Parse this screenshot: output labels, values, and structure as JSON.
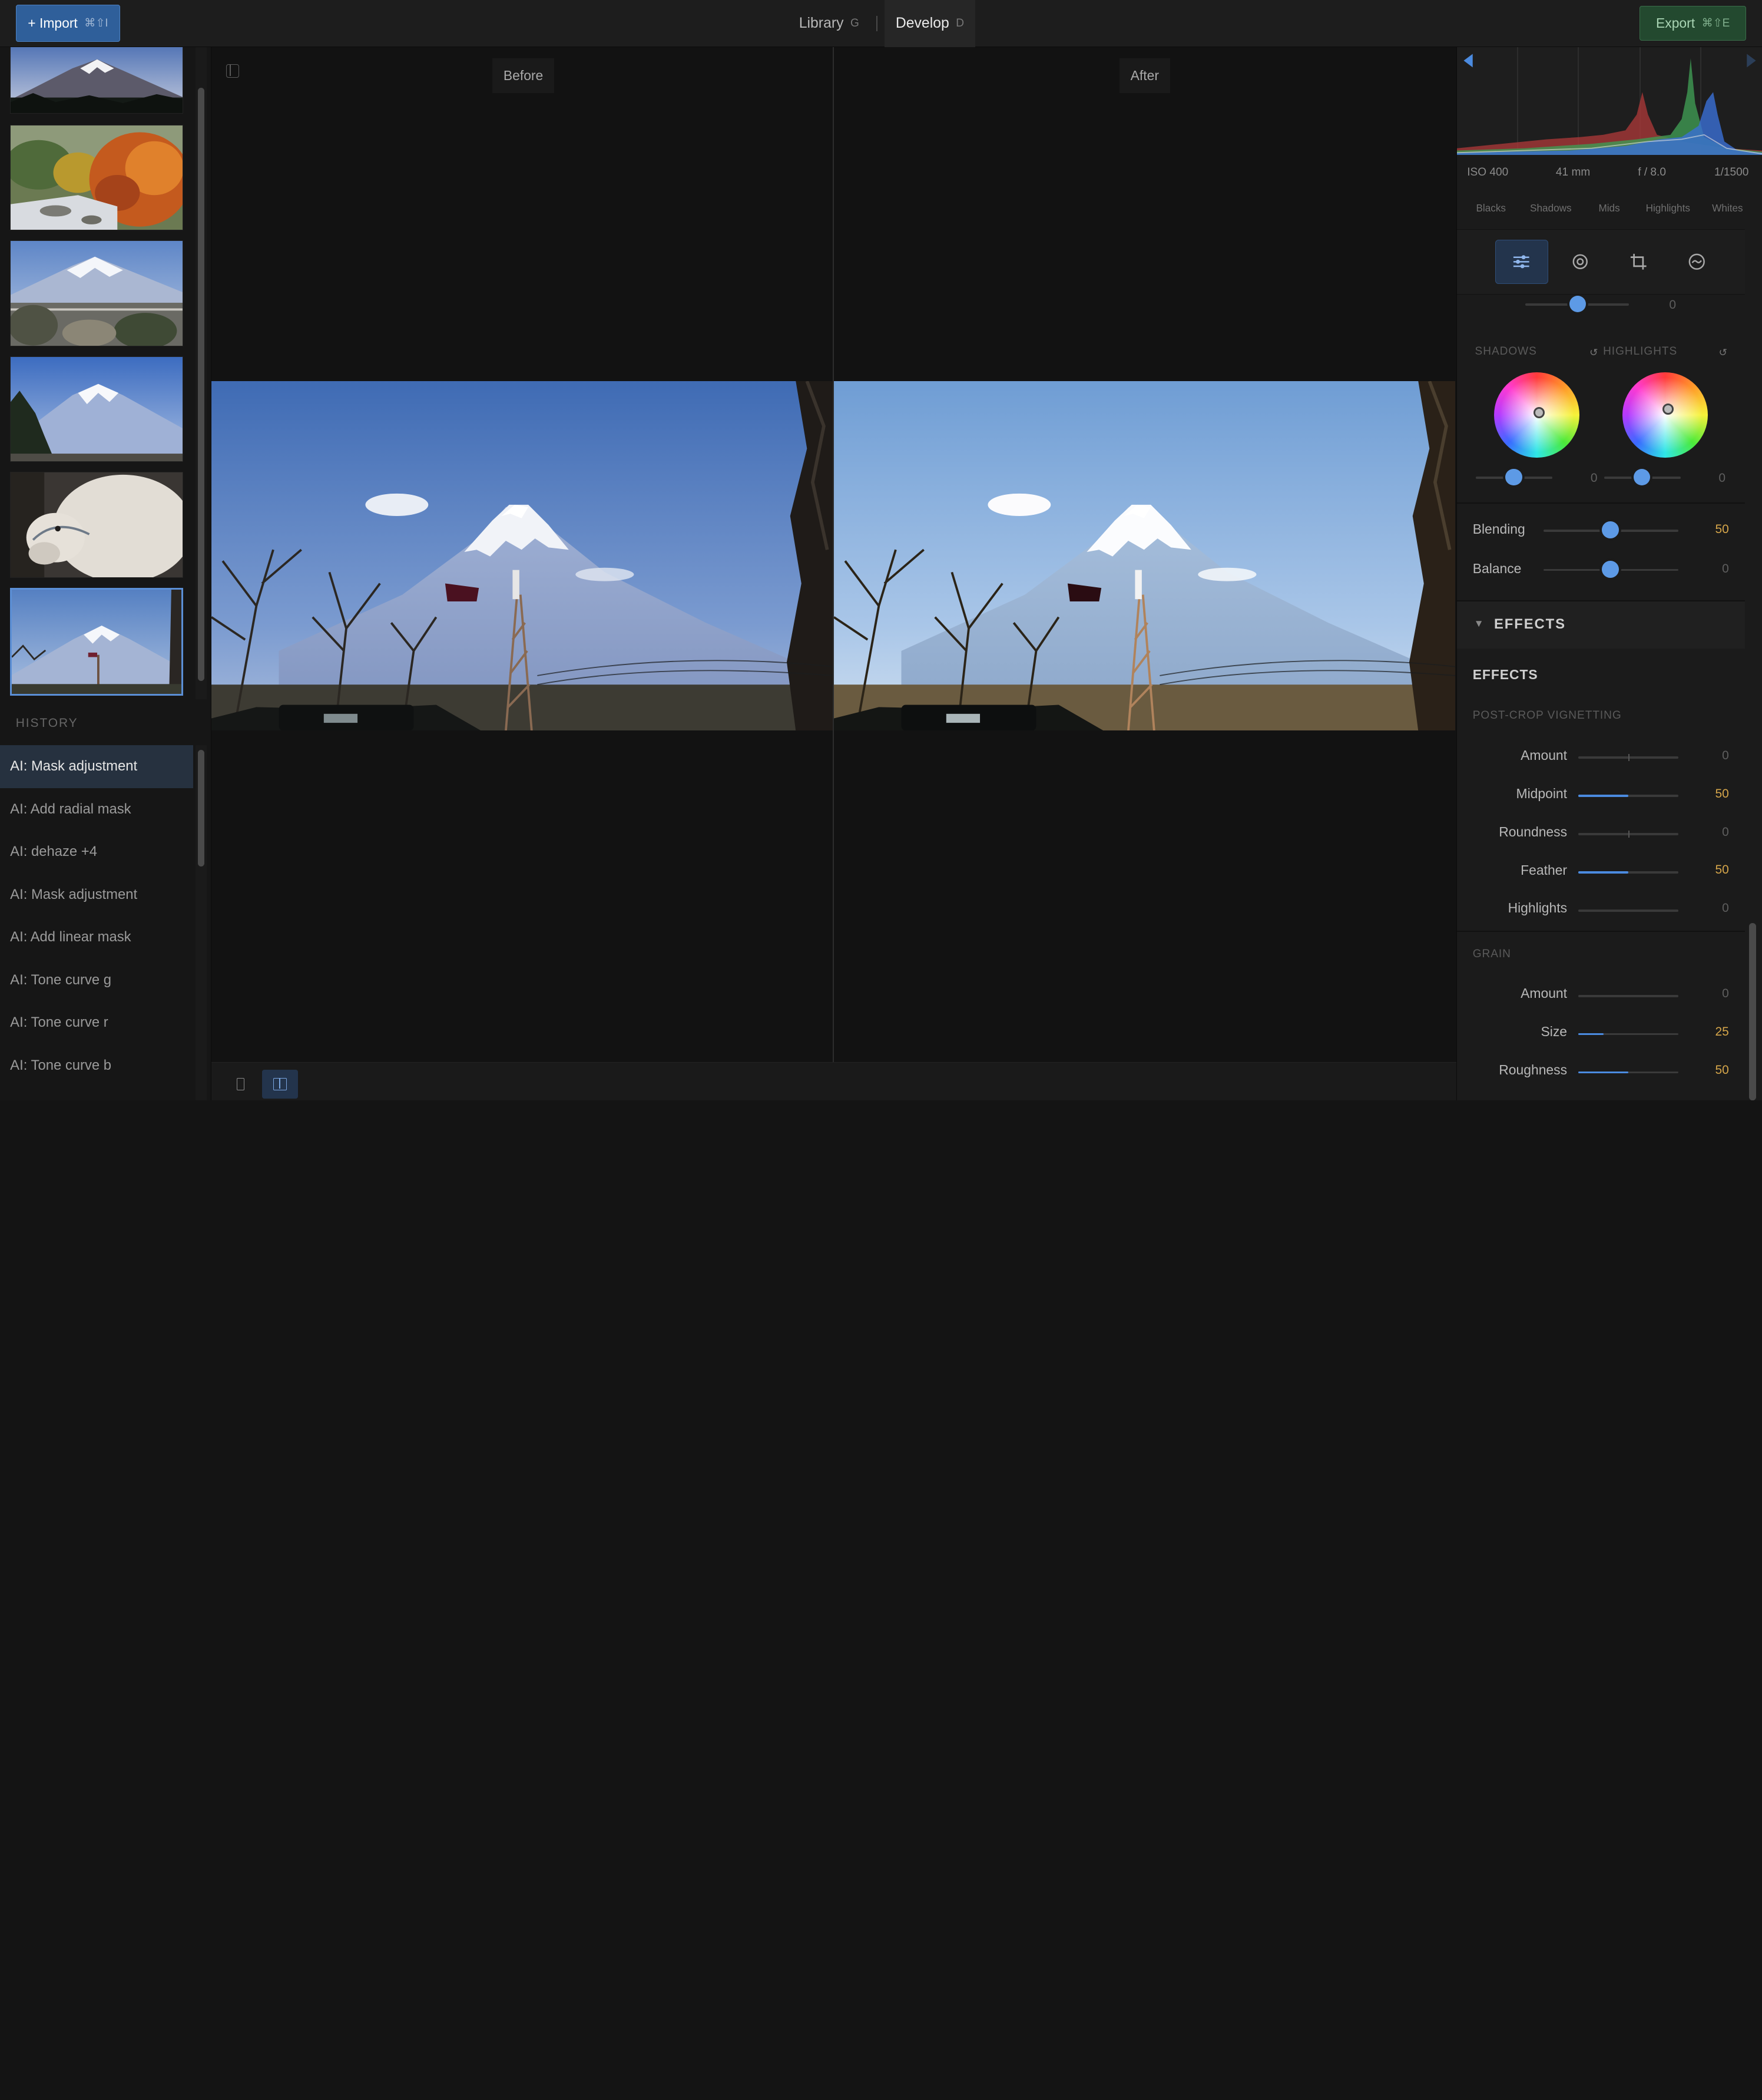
{
  "topbar": {
    "import_label": "+ Import",
    "import_shortcut": "⌘⇧I",
    "tabs": [
      {
        "label": "Library",
        "key": "G"
      },
      {
        "label": "Develop",
        "key": "D"
      }
    ],
    "export_label": "Export",
    "export_shortcut": "⌘⇧E"
  },
  "history": {
    "title": "HISTORY",
    "items": [
      "AI: Mask adjustment",
      "AI: Add radial mask",
      "AI: dehaze +4",
      "AI: Mask adjustment",
      "AI: Add linear mask",
      "AI: Tone curve g",
      "AI: Tone curve r",
      "AI: Tone curve b"
    ]
  },
  "viewer": {
    "before_label": "Before",
    "after_label": "After"
  },
  "histogram": {
    "iso": "ISO 400",
    "focal": "41 mm",
    "aperture": "f / 8.0",
    "shutter": "1/1500",
    "zones": [
      "Blacks",
      "Shadows",
      "Mids",
      "Highlights",
      "Whites"
    ]
  },
  "tools": [
    "sliders-icon",
    "target-icon",
    "crop-icon",
    "mask-icon"
  ],
  "color_grading": {
    "top_slider_value": "0",
    "top_slider_level": 0.5,
    "shadows_label": "SHADOWS",
    "highlights_label": "HIGHLIGHTS",
    "reset_symbol": "↺",
    "shadows_value": "0",
    "highlights_value": "0",
    "blending_label": "Blending",
    "blending_value": "50",
    "balance_label": "Balance",
    "balance_value": "0"
  },
  "effects": {
    "header": "EFFECTS",
    "sub_title": "EFFECTS",
    "vignette_title": "POST-CROP VIGNETTING",
    "vignette": [
      {
        "label": "Amount",
        "value": "0",
        "level": 0.5,
        "mode": "center"
      },
      {
        "label": "Midpoint",
        "value": "50",
        "level": 0.5,
        "mode": "fill"
      },
      {
        "label": "Roundness",
        "value": "0",
        "level": 0.5,
        "mode": "center"
      },
      {
        "label": "Feather",
        "value": "50",
        "level": 0.5,
        "mode": "fill"
      },
      {
        "label": "Highlights",
        "value": "0",
        "level": 0,
        "mode": "fill"
      }
    ],
    "grain_title": "GRAIN",
    "grain": [
      {
        "label": "Amount",
        "value": "0",
        "level": 0,
        "mode": "fill"
      },
      {
        "label": "Size",
        "value": "25",
        "level": 0.25,
        "mode": "fill"
      },
      {
        "label": "Roughness",
        "value": "50",
        "level": 0.5,
        "mode": "fill"
      }
    ]
  },
  "colors": {
    "accent": "#4b8be0",
    "value_highlight": "#d6a64a",
    "import_bg": "#2f5f9a",
    "export_bg": "#23492f"
  }
}
